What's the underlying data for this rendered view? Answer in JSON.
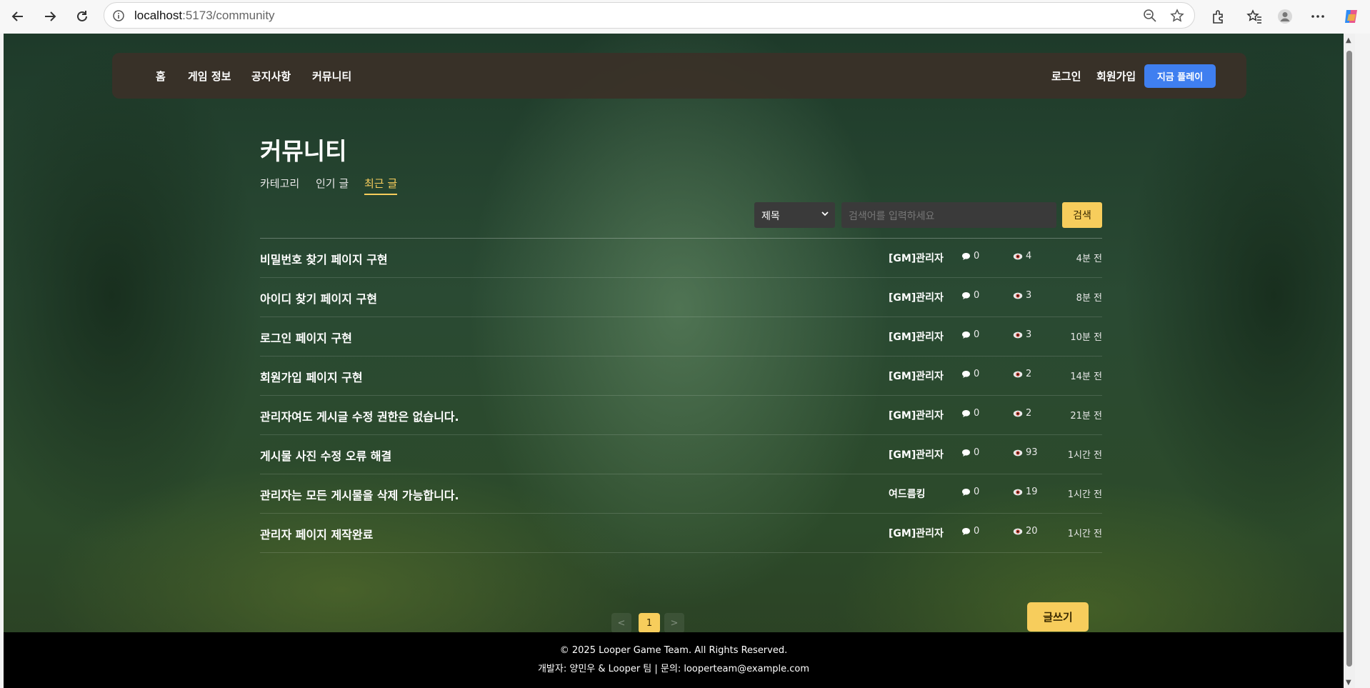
{
  "browser": {
    "url_host": "localhost",
    "url_path": ":5173/community"
  },
  "header": {
    "nav": [
      "홈",
      "게임 정보",
      "공지사항",
      "커뮤니티"
    ],
    "login": "로그인",
    "signup": "회원가입",
    "play_now": "지금 플레이"
  },
  "community": {
    "title": "커뮤니티",
    "tabs": [
      {
        "label": "카테고리",
        "active": false
      },
      {
        "label": "인기 글",
        "active": false
      },
      {
        "label": "최근 글",
        "active": true
      }
    ],
    "search": {
      "field_selected": "제목",
      "placeholder": "검색어를 입력하세요",
      "button": "검색"
    },
    "posts": [
      {
        "title": "비밀번호 찾기 페이지 구현",
        "author": "[GM]관리자",
        "comments": "0",
        "views": "4",
        "time": "4분 전"
      },
      {
        "title": "아이디 찾기 페이지 구현",
        "author": "[GM]관리자",
        "comments": "0",
        "views": "3",
        "time": "8분 전"
      },
      {
        "title": "로그인 페이지 구현",
        "author": "[GM]관리자",
        "comments": "0",
        "views": "3",
        "time": "10분 전"
      },
      {
        "title": "회원가입 페이지 구현",
        "author": "[GM]관리자",
        "comments": "0",
        "views": "2",
        "time": "14분 전"
      },
      {
        "title": "관리자여도 게시글 수정 권한은 없습니다.",
        "author": "[GM]관리자",
        "comments": "0",
        "views": "2",
        "time": "21분 전"
      },
      {
        "title": "게시물 사진 수정 오류 해결",
        "author": "[GM]관리자",
        "comments": "0",
        "views": "93",
        "time": "1시간 전"
      },
      {
        "title": "관리자는 모든 게시물을 삭제 가능합니다.",
        "author": "여드름킹",
        "comments": "0",
        "views": "19",
        "time": "1시간 전"
      },
      {
        "title": "관리자 페이지 제작완료",
        "author": "[GM]관리자",
        "comments": "0",
        "views": "20",
        "time": "1시간 전"
      }
    ],
    "pagination": {
      "prev": "<",
      "current": "1",
      "next": ">"
    },
    "write_button": "글쓰기"
  },
  "footer": {
    "copyright": "© 2025 Looper Game Team. All Rights Reserved.",
    "credits": "개발자: 양민우 & Looper 팀 | 문의: looperteam@example.com"
  },
  "colors": {
    "accent_yellow": "#f7cd5c",
    "play_blue": "#3f7ff0"
  }
}
